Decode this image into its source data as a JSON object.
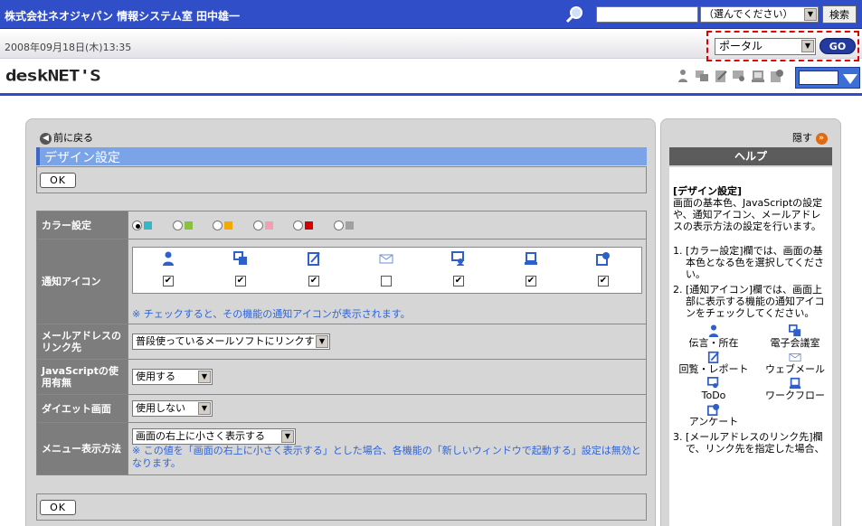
{
  "header": {
    "company": "株式会社ネオジャパン 情報システム室 田中雄一",
    "search_value": "",
    "search_select": "（選んでください）",
    "search_button": "検索"
  },
  "datebar": {
    "datetime": "2008年09月18日(木)13:35",
    "portal_select": "ポータル",
    "go_button": "GO"
  },
  "logo": {
    "text_a": "desk",
    "text_b": "NET'S"
  },
  "nav": {
    "back": "前に戻る",
    "hide": "隠す"
  },
  "page": {
    "title": "デザイン設定",
    "ok_label": "OK"
  },
  "settings": {
    "color_label": "カラー設定",
    "color_swatches": [
      "#33b8c8",
      "#88c23a",
      "#f5a800",
      "#f0a0b0",
      "#d40000",
      "#a0a0a0"
    ],
    "notify_label": "通知アイコン",
    "notify_checks": [
      true,
      true,
      true,
      false,
      true,
      true,
      true
    ],
    "notify_note": "※ チェックすると、その機能の通知アイコンが表示されます。",
    "mail_label": "メールアドレスのリンク先",
    "mail_value": "普段使っているメールソフトにリンクする",
    "js_label": "JavaScriptの使用有無",
    "js_value": "使用する",
    "diet_label": "ダイエット画面",
    "diet_value": "使用しない",
    "menu_label": "メニュー表示方法",
    "menu_value": "画面の右上に小さく表示する",
    "menu_note": "※ この値を「画面の右上に小さく表示する」とした場合、各機能の「新しいウィンドウで起動する」設定は無効となります。"
  },
  "help": {
    "header": "ヘルプ",
    "title": "[デザイン設定]",
    "intro": "画面の基本色、JavaScriptの設定や、通知アイコン、メールアドレスの表示方法の設定を行います。",
    "items": [
      "[カラー設定]欄では、画面の基本色となる色を選択してください。",
      "[通知アイコン]欄では、画面上部に表示する機能の通知アイコンをチェックしてください。",
      "[メールアドレスのリンク先]欄で、リンク先を指定した場合、"
    ],
    "icon_labels": [
      "伝言・所在",
      "電子会議室",
      "回覧・レポート",
      "ウェブメール",
      "ToDo",
      "ワークフロー",
      "アンケート"
    ]
  }
}
